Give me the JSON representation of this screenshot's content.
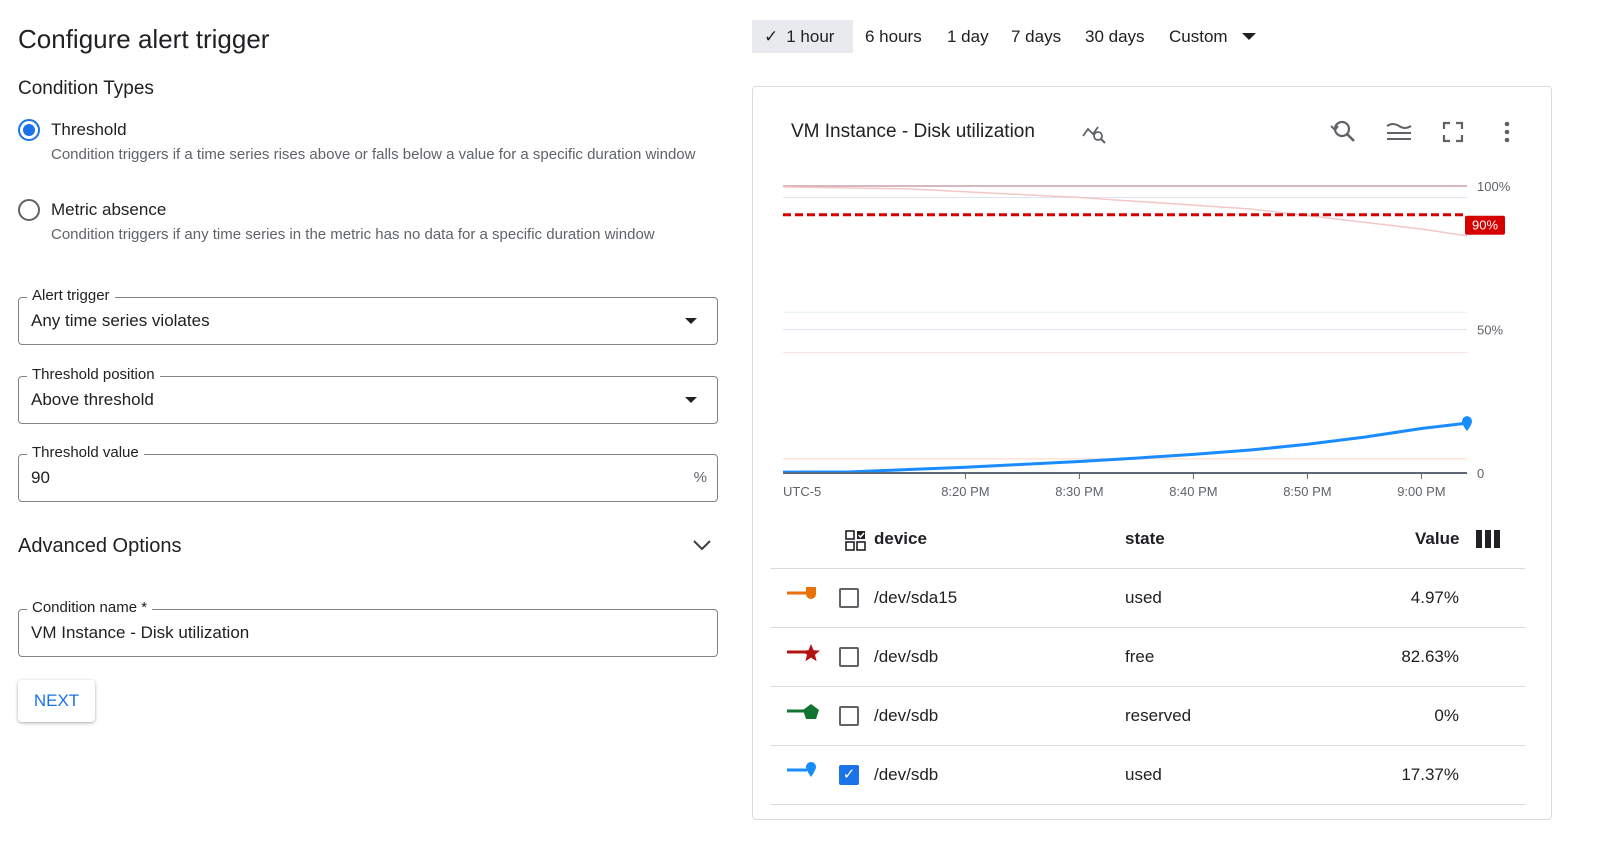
{
  "title": "Configure alert trigger",
  "condition_types": {
    "heading": "Condition Types",
    "options": [
      {
        "label": "Threshold",
        "description": "Condition triggers if a time series rises above or falls below a value for a specific duration window",
        "selected": true
      },
      {
        "label": "Metric absence",
        "description": "Condition triggers if any time series in the metric has no data for a specific duration window",
        "selected": false
      }
    ]
  },
  "alert_trigger": {
    "label": "Alert trigger",
    "value": "Any time series violates"
  },
  "threshold_position": {
    "label": "Threshold position",
    "value": "Above threshold"
  },
  "threshold_value": {
    "label": "Threshold value",
    "value": "90",
    "suffix": "%"
  },
  "advanced": {
    "label": "Advanced Options"
  },
  "condition_name": {
    "label": "Condition name *",
    "value": "VM Instance - Disk utilization"
  },
  "next_label": "NEXT",
  "time_ranges": [
    {
      "label": "1 hour",
      "selected": true
    },
    {
      "label": "6 hours"
    },
    {
      "label": "1 day"
    },
    {
      "label": "7 days"
    },
    {
      "label": "30 days"
    },
    {
      "label": "Custom"
    }
  ],
  "chart_title": "VM Instance - Disk utilization",
  "colors": {
    "accent": "#1a73e8",
    "threshold": "#d50000",
    "orange": "#e8710a",
    "red": "#b31412",
    "green": "#137333",
    "blue": "#1a8cff"
  },
  "chart_data": {
    "type": "line",
    "timezone": "UTC-5",
    "x_ticks": [
      "8:20 PM",
      "8:30 PM",
      "8:40 PM",
      "8:50 PM",
      "9:00 PM"
    ],
    "y_ticks": [
      "100%",
      "50%",
      "0"
    ],
    "ylim": [
      0,
      100
    ],
    "xlim": [
      "20:04",
      "21:04"
    ],
    "threshold": {
      "value": 90,
      "label": "90%"
    },
    "series": [
      {
        "name": "/dev/sdb used",
        "emphasis": true,
        "x": [
          "20:04",
          "20:10",
          "20:15",
          "20:20",
          "20:25",
          "20:30",
          "20:35",
          "20:40",
          "20:45",
          "20:50",
          "20:55",
          "21:00",
          "21:04"
        ],
        "y": [
          0.3,
          0.4,
          1.2,
          2,
          3,
          4,
          5.2,
          6.5,
          8,
          10,
          12.5,
          15.5,
          17.37
        ]
      },
      {
        "name": "/dev/sdb free",
        "emphasis": false,
        "x": [
          "20:04",
          "20:15",
          "20:30",
          "20:45",
          "21:00",
          "21:04"
        ],
        "y": [
          99.7,
          99,
          96,
          92,
          85,
          82.63
        ]
      },
      {
        "name": "/dev/sda15 used",
        "emphasis": false,
        "x": [
          "20:04",
          "21:04"
        ],
        "y": [
          4.97,
          4.97
        ]
      },
      {
        "name": "/dev/sdb reserved",
        "emphasis": false,
        "x": [
          "20:04",
          "21:04"
        ],
        "y": [
          0,
          0
        ]
      }
    ]
  },
  "table": {
    "headers": [
      "device",
      "state",
      "Value"
    ],
    "rows": [
      {
        "device": "/dev/sda15",
        "state": "used",
        "value": "4.97%",
        "checked": false,
        "marker": "shield",
        "color": "#e8710a"
      },
      {
        "device": "/dev/sdb",
        "state": "free",
        "value": "82.63%",
        "checked": false,
        "marker": "star",
        "color": "#b31412"
      },
      {
        "device": "/dev/sdb",
        "state": "reserved",
        "value": "0%",
        "checked": false,
        "marker": "pentagon",
        "color": "#137333"
      },
      {
        "device": "/dev/sdb",
        "state": "used",
        "value": "17.37%",
        "checked": true,
        "marker": "pin",
        "color": "#1a8cff"
      }
    ]
  }
}
